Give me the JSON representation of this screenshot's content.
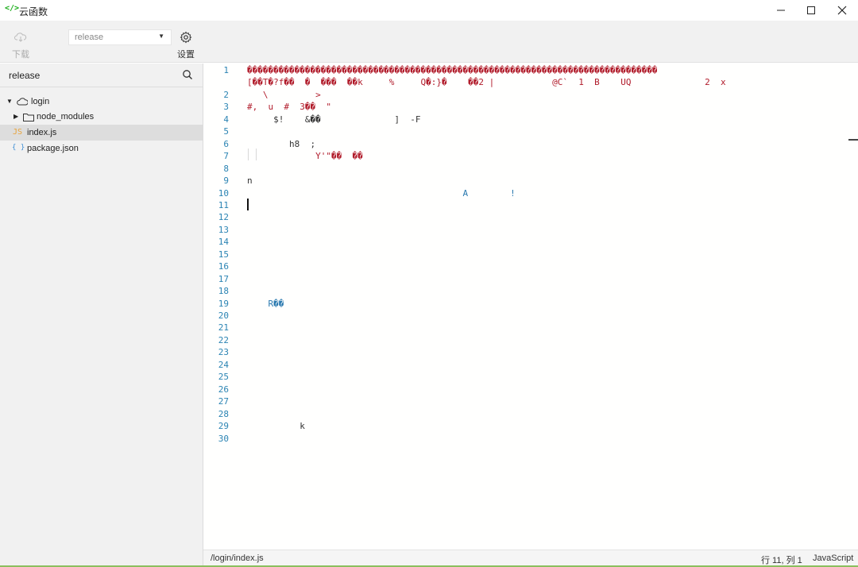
{
  "window": {
    "app_icon": "</>",
    "title": "云函数",
    "controls": {
      "minimize": "minimize-icon",
      "maximize": "maximize-icon",
      "close": "close-icon"
    }
  },
  "toolbar": {
    "download_label": "下载",
    "env_select_value": "release",
    "settings_label": "设置"
  },
  "sidebar": {
    "search_value": "release",
    "tree": [
      {
        "label": "login",
        "icon": "cloud-icon",
        "expanded": true
      },
      {
        "label": "node_modules",
        "icon": "folder-icon",
        "expanded": false
      },
      {
        "label": "index.js",
        "icon": "js-file-icon",
        "badge": "JS",
        "selected": true
      },
      {
        "label": "package.json",
        "icon": "json-file-icon",
        "badge": "{ }"
      }
    ]
  },
  "editor": {
    "line_numbers": [
      "1",
      "2",
      "3",
      "4",
      "5",
      "6",
      "7",
      "8",
      "9",
      "10",
      "11",
      "12",
      "13",
      "14",
      "15",
      "16",
      "17",
      "18",
      "19",
      "20",
      "21",
      "22",
      "23",
      "24",
      "25",
      "26",
      "27",
      "28",
      "29",
      "30"
    ],
    "lines": [
      {
        "text": "������������������������������������������������������������������������������",
        "color": "#b11c2b"
      },
      {
        "text": "[��T�?f��  �  ���  ��k     %     Q�:}�    ��2 |           @C`  1  B    UQ              2  x",
        "color": "#b11c2b"
      },
      {
        "text": "   \\         >",
        "color": "#b11c2b"
      },
      {
        "text": "#,  u  #  3��  \"",
        "color": "#b11c2b"
      },
      {
        "text": "     $!    &��              ]  -F",
        "color": "#333333"
      },
      {
        "text": "",
        "color": "#333333"
      },
      {
        "text": "        h8  ;",
        "color": "#333333"
      },
      {
        "text": "             Y'\"��  ��",
        "color": "#b11c2b"
      },
      {
        "text": "",
        "color": "#333333"
      },
      {
        "text": "n",
        "color": "#333333"
      },
      {
        "text": "                                         A        !",
        "color": "#2b7ab0"
      },
      {
        "text": "",
        "color": "#333333"
      },
      {
        "text": "",
        "color": "#333333"
      },
      {
        "text": "",
        "color": "#333333"
      },
      {
        "text": "",
        "color": "#333333"
      },
      {
        "text": "",
        "color": "#333333"
      },
      {
        "text": "",
        "color": "#333333"
      },
      {
        "text": "",
        "color": "#333333"
      },
      {
        "text": "",
        "color": "#333333"
      },
      {
        "text": "    R��",
        "color": "#2b7ab0"
      },
      {
        "text": "",
        "color": "#333333"
      },
      {
        "text": "",
        "color": "#333333"
      },
      {
        "text": "",
        "color": "#333333"
      },
      {
        "text": "",
        "color": "#333333"
      },
      {
        "text": "",
        "color": "#333333"
      },
      {
        "text": "",
        "color": "#333333"
      },
      {
        "text": "",
        "color": "#333333"
      },
      {
        "text": "",
        "color": "#333333"
      },
      {
        "text": "",
        "color": "#333333"
      },
      {
        "text": "          k",
        "color": "#333333"
      }
    ]
  },
  "statusbar": {
    "path": "/login/index.js",
    "position": "行 11, 列 1",
    "language": "JavaScript"
  }
}
